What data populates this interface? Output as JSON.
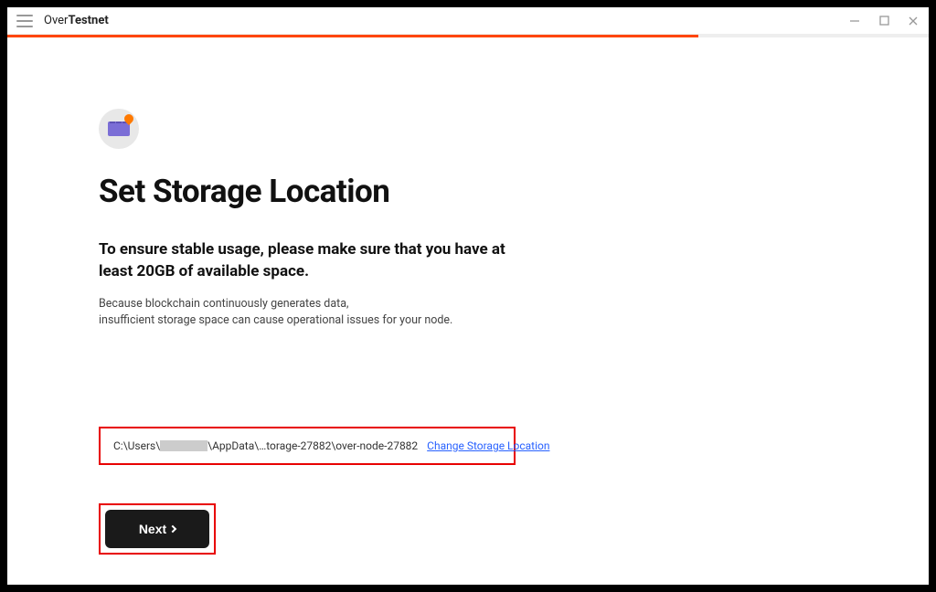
{
  "titlebar": {
    "brand_light": "Over",
    "brand_bold": "Testnet"
  },
  "progress": {
    "percent": 75
  },
  "page": {
    "heading": "Set Storage Location",
    "subheading": "To ensure stable usage, please make sure that you have at least 20GB of available space.",
    "description_line1": "Because blockchain continuously generates data,",
    "description_line2": "insufficient storage space can cause operational issues for your node."
  },
  "storage": {
    "path_prefix": "C:\\Users\\",
    "path_suffix": "\\AppData\\…torage-27882\\over-node-27882",
    "change_link": "Change Storage Location"
  },
  "buttons": {
    "next": "Next"
  }
}
